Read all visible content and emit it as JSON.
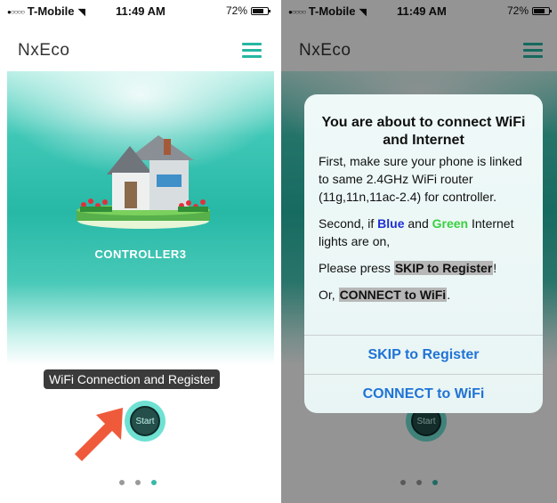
{
  "status_bar": {
    "carrier": "T-Mobile",
    "signal_dots": "●○○○○",
    "time": "11:49 AM",
    "battery": "72%"
  },
  "app": {
    "title": "NxEco"
  },
  "home": {
    "controller_name": "CONTROLLER3",
    "wifi_label": "WiFi Connection and Register",
    "start_label": "Start"
  },
  "alert": {
    "title": "You are about to connect WiFi and Internet",
    "para1": "First, make sure your phone is linked to same 2.4GHz WiFi router (11g,11n,11ac-2.4) for controller.",
    "para2_prefix": "Second, if",
    "para2_blue": "Blue",
    "para2_and": "and",
    "para2_green": "Green",
    "para2_suffix": "Internet lights are on,",
    "para3_prefix": "Please press",
    "para3_highlight": "SKIP to Register",
    "para3_suffix": "!",
    "para4_prefix": "Or,",
    "para4_highlight": "CONNECT to WiFi",
    "para4_suffix": ".",
    "skip_button": "SKIP to Register",
    "connect_button": "CONNECT to WiFi"
  },
  "colors": {
    "accent": "#26b6a2",
    "alert_button": "#1f73d6",
    "blue_word": "#1f2fd6",
    "green_word": "#3ad040"
  },
  "pager": {
    "count": 3,
    "active_index": 2
  }
}
